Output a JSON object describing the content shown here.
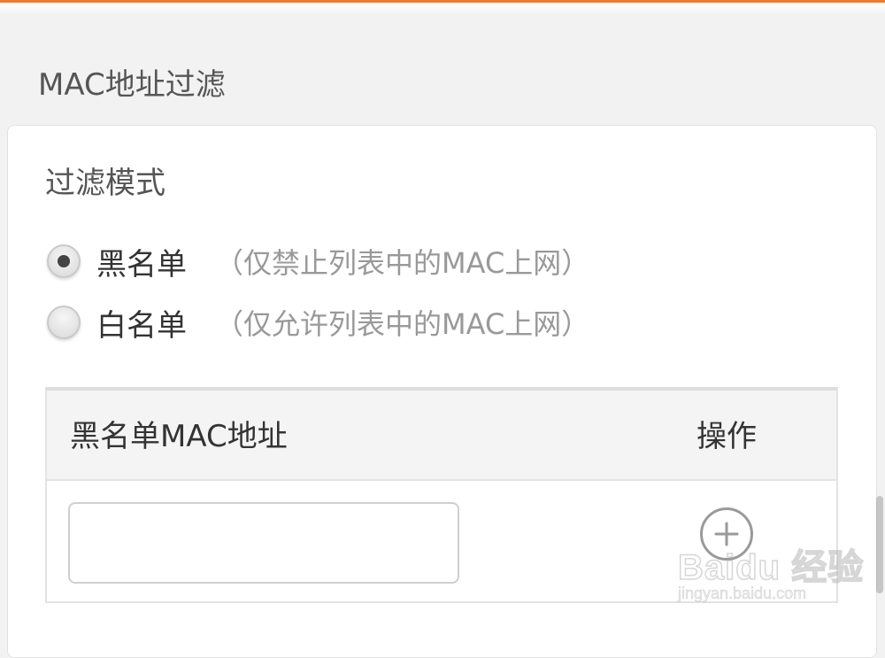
{
  "section": {
    "title": "MAC地址过滤"
  },
  "filter_mode": {
    "label": "过滤模式",
    "options": [
      {
        "label": "黑名单",
        "desc": "（仅禁止列表中的MAC上网）",
        "selected": true
      },
      {
        "label": "白名单",
        "desc": "（仅允许列表中的MAC上网）",
        "selected": false
      }
    ]
  },
  "mac_table": {
    "headers": {
      "mac": "黑名单MAC地址",
      "operation": "操作"
    },
    "rows": [
      {
        "mac_value": "",
        "action_icon": "add-circle-icon"
      }
    ]
  },
  "watermark": {
    "main": "Baidu 经验",
    "sub": "jingyan.baidu.com"
  },
  "colors": {
    "accent": "#f07a2a"
  }
}
